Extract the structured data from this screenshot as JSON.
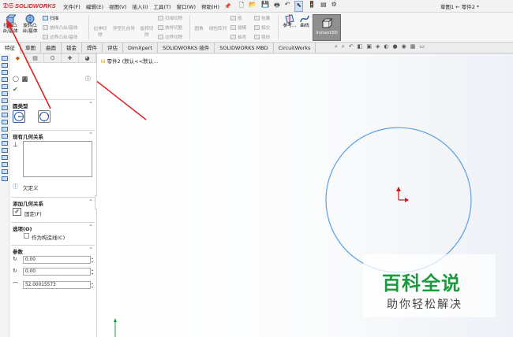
{
  "app": {
    "brand": "SOLIDWORKS",
    "document_title": "草图1 ← 零件2 *"
  },
  "menu": [
    "文件(F)",
    "编辑(E)",
    "视图(V)",
    "插入(I)",
    "工具(T)",
    "窗口(W)",
    "帮助(H)"
  ],
  "ribbon": {
    "extrude": "拉伸凸台/基体",
    "revolve": "旋转凸台/基体",
    "sweep": "扫描",
    "loft": "放样凸台/基体",
    "boundary": "边界凸台/基体",
    "extrude_cut": "拉伸切除",
    "hole_wizard": "异型孔向导",
    "revolve_cut": "旋转切除",
    "sweep_cut": "扫描切除",
    "loft_cut": "放样切割",
    "boundary_cut": "边界切除",
    "fillet": "圆角",
    "linear_pattern": "线性阵列",
    "rib": "筋",
    "wrap": "包覆",
    "draft": "拔模",
    "intersect": "相交",
    "shell": "抽壳",
    "mirror": "镜向",
    "reference": "参考...",
    "curves": "曲线",
    "instant3d": "Instant3D"
  },
  "tabs": [
    "特征",
    "草图",
    "曲面",
    "钣金",
    "焊件",
    "评估",
    "DimXpert",
    "SOLIDWORKS 插件",
    "SOLIDWORKS MBD",
    "CircuitWorks"
  ],
  "property_manager": {
    "title": "圆",
    "sections": {
      "circle_type": "圆类型",
      "existing_relations": "现有几何关系",
      "under_defined": "欠定义",
      "add_relations": "添加几何关系",
      "fix": "固定(F)",
      "options": "选项(O)",
      "construction": "作为构造线(C)",
      "parameters": "参数"
    },
    "params": {
      "cx": "0.00",
      "cy": "0.00",
      "radius": "52.00015573"
    }
  },
  "tree": {
    "part": "零件2 (默认<<默认..."
  },
  "watermark": {
    "title": "百科全说",
    "subtitle": "助你轻松解决"
  },
  "colors": {
    "circle": "#5aa0e6",
    "arrow": "#e02020",
    "accent": "#d2232a"
  }
}
